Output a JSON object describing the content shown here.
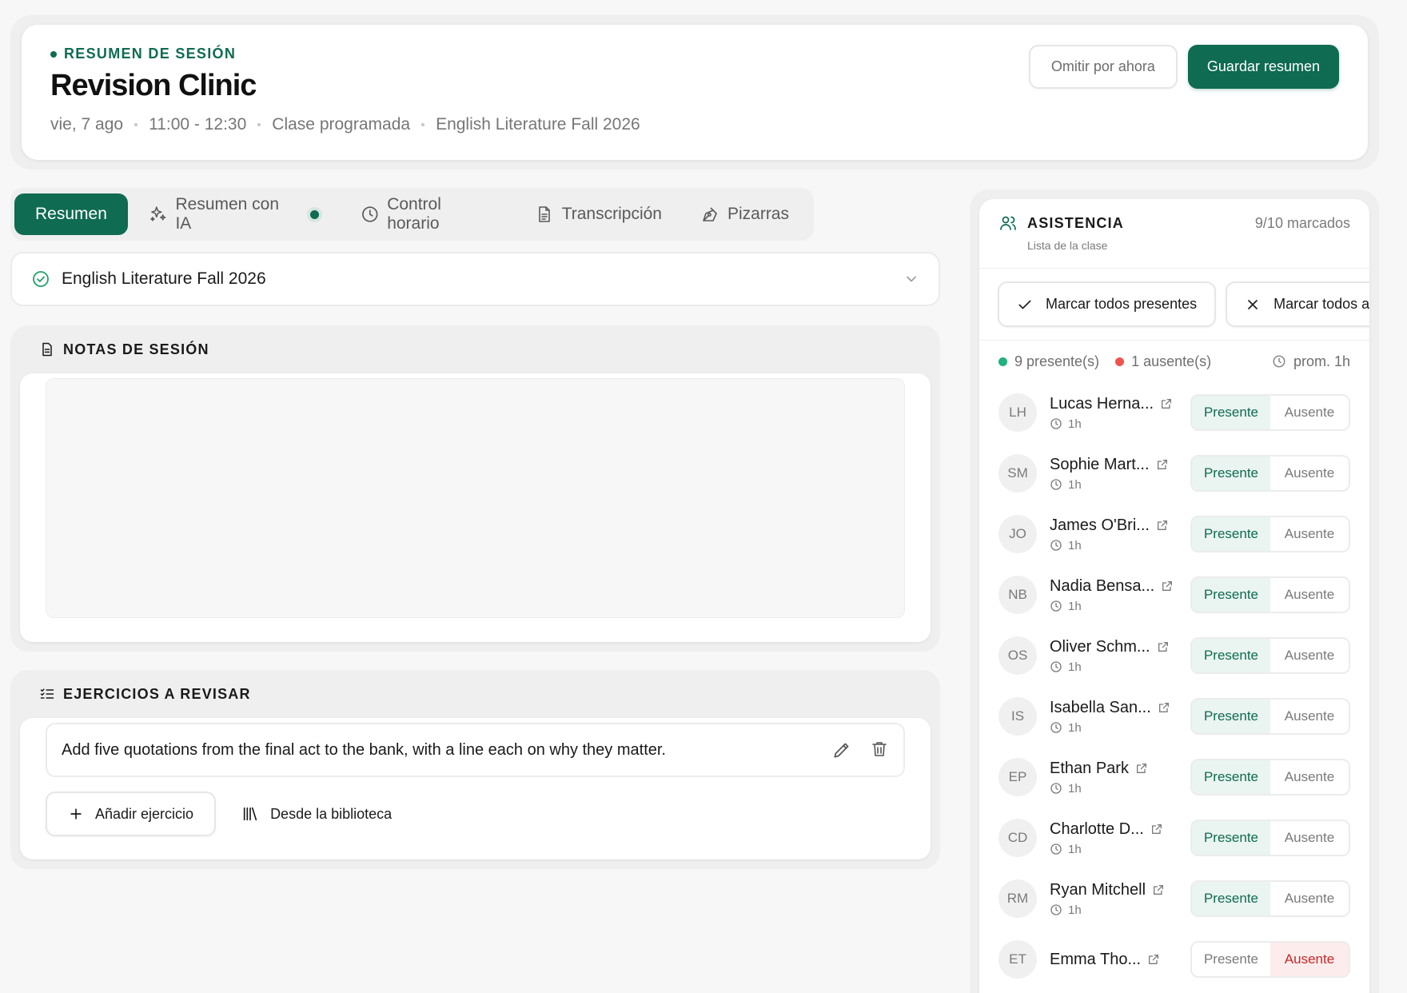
{
  "header": {
    "eyebrow": "RESUMEN DE SESIÓN",
    "title": "Revision Clinic",
    "meta": [
      "vie, 7 ago",
      "11:00 - 12:30",
      "Clase programada",
      "English Literature Fall 2026"
    ],
    "skip_label": "Omitir por ahora",
    "save_label": "Guardar resumen"
  },
  "tabs": [
    {
      "label": "Resumen",
      "icon": "none"
    },
    {
      "label": "Resumen con IA",
      "icon": "sparkles-icon"
    },
    {
      "label": "Control horario",
      "icon": "clock-icon"
    },
    {
      "label": "Transcripción",
      "icon": "document-icon"
    },
    {
      "label": "Pizarras",
      "icon": "pen-tool-icon"
    }
  ],
  "active_tab": "Resumen",
  "class_select": {
    "value": "English Literature Fall 2026"
  },
  "notes": {
    "title": "NOTAS DE SESIÓN",
    "content": ""
  },
  "exercises": {
    "title": "EJERCICIOS A REVISAR",
    "items": [
      {
        "text": "Add five quotations from the final act to the bank, with a line each on why they matter."
      }
    ],
    "add_label": "Añadir ejercicio",
    "library_label": "Desde la biblioteca"
  },
  "attendance": {
    "title": "ASISTENCIA",
    "subtitle": "Lista de la clase",
    "count": "9/10 marcados",
    "mark_all_present": "Marcar todos presentes",
    "mark_all_absent": "Marcar todos ausentes",
    "present_summary": "9 presente(s)",
    "absent_summary": "1 ausente(s)",
    "avg": "prom. 1h",
    "present_label": "Presente",
    "absent_label": "Ausente",
    "colors": {
      "accent": "#0f6b52",
      "present_dot": "#22b07d",
      "absent_dot": "#ef5350",
      "absent_text": "#c62828"
    },
    "students": [
      {
        "initials": "LH",
        "name": "Lucas Herna...",
        "duration": "1h",
        "status": "present"
      },
      {
        "initials": "SM",
        "name": "Sophie Mart...",
        "duration": "1h",
        "status": "present"
      },
      {
        "initials": "JO",
        "name": "James O'Bri...",
        "duration": "1h",
        "status": "present"
      },
      {
        "initials": "NB",
        "name": "Nadia Bensa...",
        "duration": "1h",
        "status": "present"
      },
      {
        "initials": "OS",
        "name": "Oliver Schm...",
        "duration": "1h",
        "status": "present"
      },
      {
        "initials": "IS",
        "name": "Isabella San...",
        "duration": "1h",
        "status": "present"
      },
      {
        "initials": "EP",
        "name": "Ethan Park",
        "duration": "1h",
        "status": "present"
      },
      {
        "initials": "CD",
        "name": "Charlotte D...",
        "duration": "1h",
        "status": "present"
      },
      {
        "initials": "RM",
        "name": "Ryan Mitchell",
        "duration": "1h",
        "status": "present"
      },
      {
        "initials": "ET",
        "name": "Emma Tho...",
        "duration": "",
        "status": "absent"
      }
    ]
  }
}
